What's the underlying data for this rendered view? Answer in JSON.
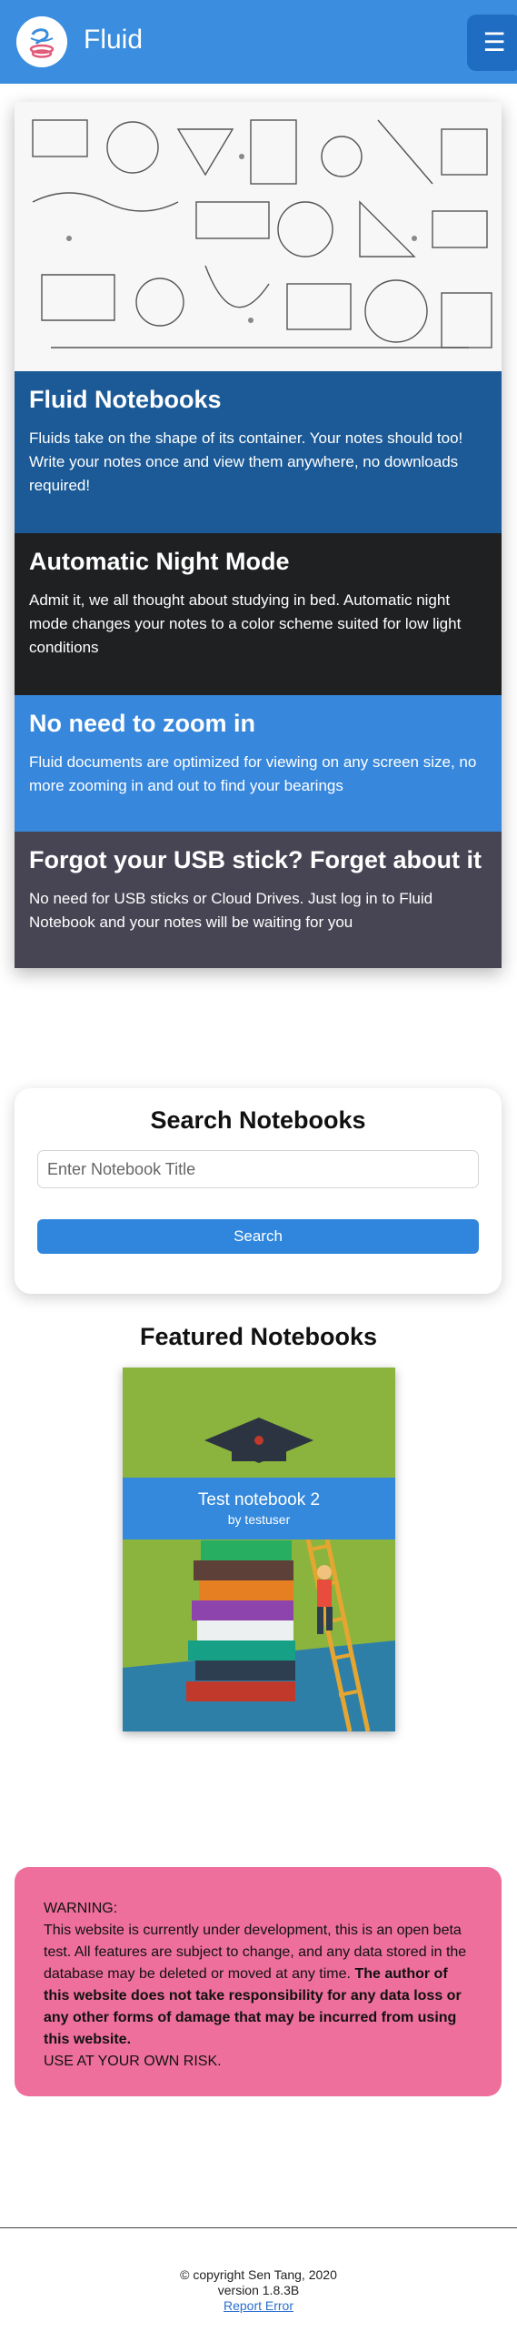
{
  "navbar": {
    "brand": "Fluid",
    "menu_icon": "hamburger-icon",
    "logo_icon": "fluid-logo-icon"
  },
  "features": [
    {
      "title": "Fluid Notebooks",
      "text": "Fluids take on the shape of its container. Your notes should too! Write your notes once and view them anywhere, no downloads required!",
      "color": "#1b5a97"
    },
    {
      "title": "Automatic Night Mode",
      "text": "Admit it, we all thought about studying in bed. Automatic night mode changes your notes to a color scheme suited for low light conditions",
      "color": "#1f2022"
    },
    {
      "title": "No need to zoom in",
      "text": "Fluid documents are optimized for viewing on any screen size, no more zooming in and out to find your bearings",
      "color": "#3787dc"
    },
    {
      "title": "Forgot your USB stick? Forget about it",
      "text": "No need for USB sticks or Cloud Drives. Just log in to Fluid Notebook and your notes will be waiting for you",
      "color": "#474554"
    }
  ],
  "search": {
    "title": "Search Notebooks",
    "placeholder": "Enter Notebook Title",
    "button_label": "Search"
  },
  "featured": {
    "title": "Featured Notebooks",
    "items": [
      {
        "title": "Test notebook 2",
        "author": "by testuser"
      }
    ]
  },
  "warning": {
    "heading": "WARNING:",
    "text": "This website is currently under development, this is an open beta test. All features are subject to change, and any data stored in the database may be deleted or moved at any time.",
    "bold_text": "The author of this website does not take responsibility for any data loss or any other forms of damage that may be incurred from using this website.",
    "footer_text": "USE AT YOUR OWN RISK."
  },
  "footer": {
    "copyright": "© copyright Sen Tang, 2020",
    "version": "version 1.8.3B",
    "report_link": "Report Error"
  },
  "colors": {
    "navbar": "#3a8ddf",
    "menu_button": "#1f6dc2",
    "search_button": "#2f86dc",
    "warning_bg": "#ee6f9b",
    "notebook_cover": "#8ab43e"
  }
}
